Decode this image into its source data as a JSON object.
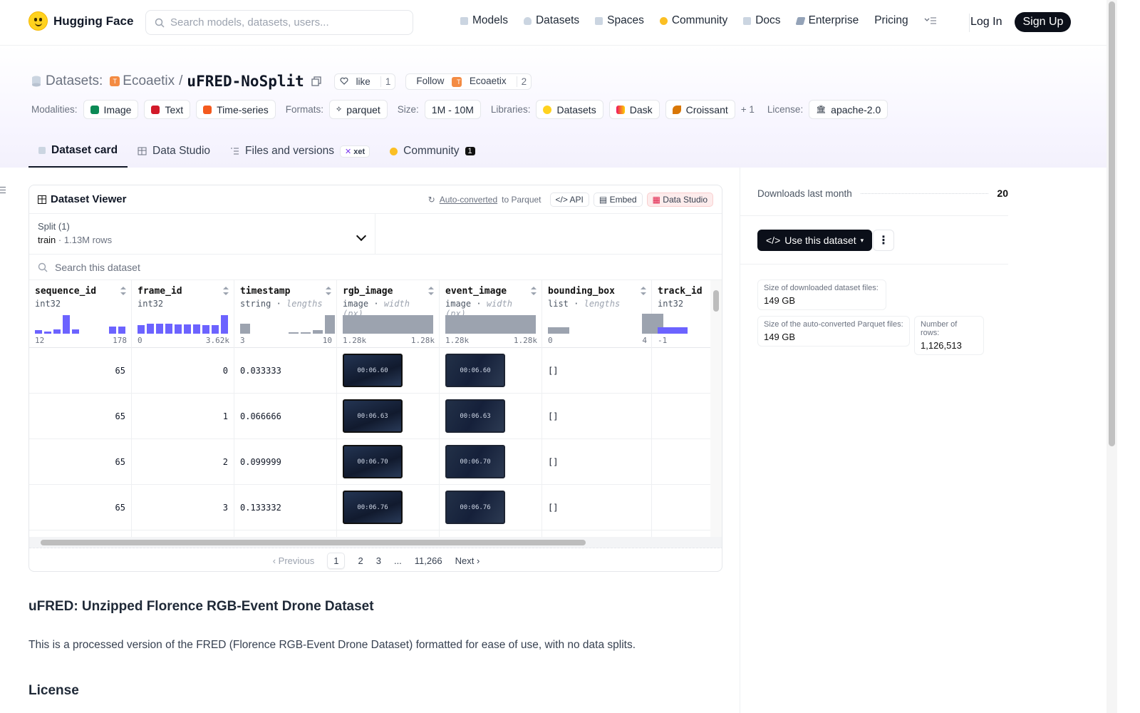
{
  "nav": {
    "brand": "Hugging Face",
    "search_placeholder": "Search models, datasets, users...",
    "items": [
      "Models",
      "Datasets",
      "Spaces",
      "Community",
      "Docs",
      "Enterprise",
      "Pricing"
    ],
    "login": "Log In",
    "signup": "Sign Up"
  },
  "header": {
    "prefix": "Datasets:",
    "org": "Ecoaetix",
    "sep": "/",
    "name": "uFRED-NoSplit",
    "like_label": "like",
    "like_count": "1",
    "follow_label": "Follow",
    "follow_org": "Ecoaetix",
    "follow_count": "2",
    "modalities_label": "Modalities:",
    "modalities": [
      "Image",
      "Text",
      "Time-series"
    ],
    "formats_label": "Formats:",
    "format": "parquet",
    "size_label": "Size:",
    "size": "1M - 10M",
    "libraries_label": "Libraries:",
    "libraries": [
      "Datasets",
      "Dask",
      "Croissant"
    ],
    "libraries_more": "+ 1",
    "license_label": "License:",
    "license": "apache-2.0"
  },
  "tabs": {
    "card": "Dataset card",
    "studio": "Data Studio",
    "files": "Files and versions",
    "xet": "xet",
    "community": "Community",
    "community_count": "1"
  },
  "viewer": {
    "title": "Dataset Viewer",
    "autoconv": "Auto-converted",
    "to_parquet": "to Parquet",
    "api": "API",
    "embed": "Embed",
    "studio": "Data Studio",
    "split_label": "Split (1)",
    "split_value": "train",
    "split_rows": "1.13M rows",
    "search_placeholder": "Search this dataset",
    "columns": [
      {
        "name": "sequence_id",
        "type": "int32",
        "hint": "",
        "min": "12",
        "max": "178"
      },
      {
        "name": "frame_id",
        "type": "int32",
        "hint": "",
        "min": "0",
        "max": "3.62k"
      },
      {
        "name": "timestamp",
        "type": "string",
        "hint": "lengths",
        "min": "3",
        "max": "10"
      },
      {
        "name": "rgb_image",
        "type": "image",
        "hint": "width (px)",
        "min": "1.28k",
        "max": "1.28k"
      },
      {
        "name": "event_image",
        "type": "image",
        "hint": "width (px)",
        "min": "1.28k",
        "max": "1.28k"
      },
      {
        "name": "bounding_box",
        "type": "list",
        "hint": "lengths",
        "min": "0",
        "max": "4"
      },
      {
        "name": "track_id",
        "type": "int32",
        "hint": "",
        "min": "-1",
        "max": ""
      }
    ],
    "rows": [
      {
        "sequence_id": "65",
        "frame_id": "0",
        "timestamp": "0.033333",
        "rgb": "00:06.60",
        "event": "00:06.60",
        "bbox": "[]"
      },
      {
        "sequence_id": "65",
        "frame_id": "1",
        "timestamp": "0.066666",
        "rgb": "00:06.63",
        "event": "00:06.63",
        "bbox": "[]"
      },
      {
        "sequence_id": "65",
        "frame_id": "2",
        "timestamp": "0.099999",
        "rgb": "00:06.70",
        "event": "00:06.70",
        "bbox": "[]"
      },
      {
        "sequence_id": "65",
        "frame_id": "3",
        "timestamp": "0.133332",
        "rgb": "00:06.76",
        "event": "00:06.76",
        "bbox": "[]"
      }
    ],
    "pager": {
      "prev": "Previous",
      "p1": "1",
      "p2": "2",
      "p3": "3",
      "dots": "...",
      "last": "11,266",
      "next": "Next"
    }
  },
  "sidebar": {
    "downloads_label": "Downloads last month",
    "downloads": "20",
    "use_button": "Use this dataset",
    "downloaded_size_label": "Size of downloaded dataset files:",
    "downloaded_size": "149 GB",
    "parquet_size_label": "Size of the auto-converted Parquet files:",
    "parquet_size": "149 GB",
    "rows_label": "Number of rows:",
    "rows": "1,126,513"
  },
  "readme": {
    "title": "uFRED: Unzipped Florence RGB-Event Drone Dataset",
    "desc": "This is a processed version of the FRED (Florence RGB-Event Drone Dataset) formatted for ease of use, with no data splits.",
    "license_heading": "License"
  },
  "colors": {
    "accent": "#6c63ff",
    "dark": "#0b0f19",
    "hf_yellow": "#ffd21e",
    "studio_red": "#fdecec"
  }
}
